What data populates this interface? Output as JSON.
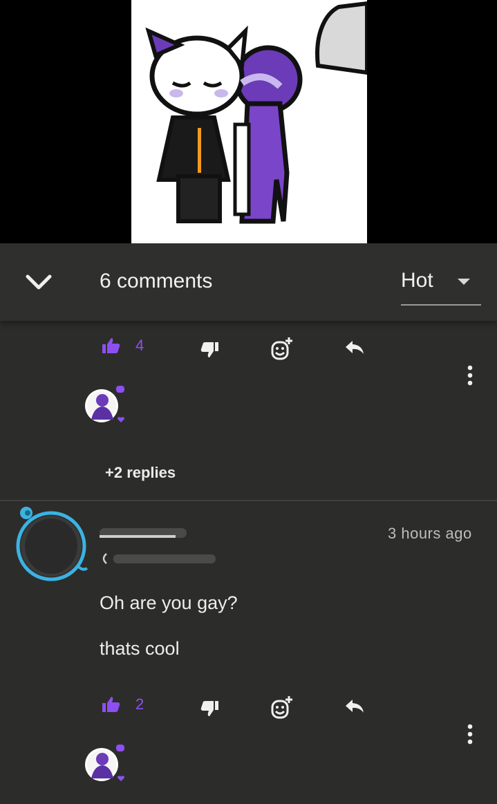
{
  "header": {
    "comments_label": "6 comments",
    "sort_label": "Hot"
  },
  "comment_1": {
    "likes": "4",
    "replies_label": "+2 replies"
  },
  "comment_2": {
    "timestamp": "3 hours ago",
    "lines": [
      "Oh are you gay?",
      "thats cool"
    ],
    "likes": "2"
  },
  "colors": {
    "background": "#2c2d2b",
    "accent": "#8e4ff2",
    "text": "#ededed"
  },
  "icons": [
    "chevron-down-icon",
    "caret-down-icon",
    "thumbs-up-icon",
    "thumbs-down-icon",
    "add-reaction-icon",
    "reply-icon",
    "more-vertical-icon"
  ]
}
